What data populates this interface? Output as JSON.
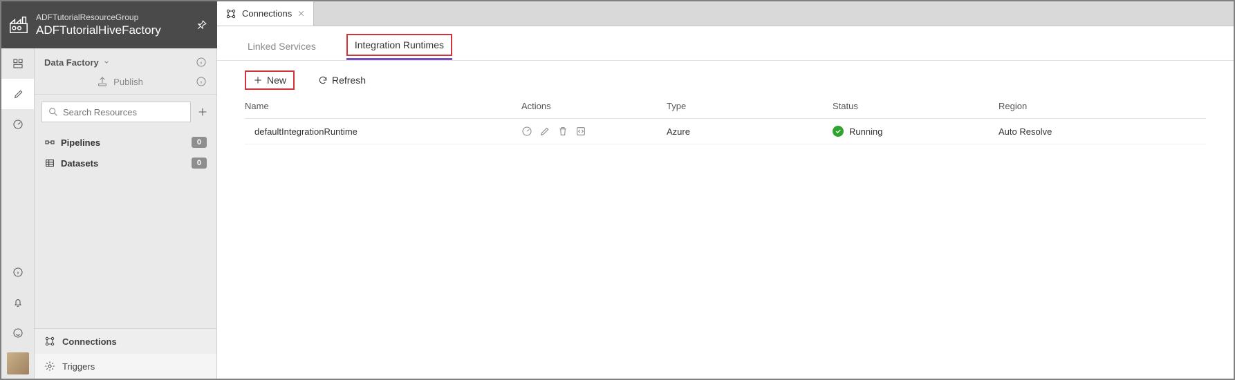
{
  "header": {
    "resource_group": "ADFTutorialResourceGroup",
    "factory_name": "ADFTutorialHiveFactory"
  },
  "sidebar": {
    "breadcrumb": "Data Factory",
    "publish_label": "Publish",
    "search_placeholder": "Search Resources",
    "tree": [
      {
        "label": "Pipelines",
        "count": "0"
      },
      {
        "label": "Datasets",
        "count": "0"
      }
    ],
    "bottom": [
      {
        "label": "Connections"
      },
      {
        "label": "Triggers"
      }
    ]
  },
  "document_tab": {
    "title": "Connections"
  },
  "subtabs": {
    "linked_services": "Linked Services",
    "integration_runtimes": "Integration Runtimes"
  },
  "toolbar": {
    "new_label": "New",
    "refresh_label": "Refresh"
  },
  "table": {
    "headers": {
      "name": "Name",
      "actions": "Actions",
      "type": "Type",
      "status": "Status",
      "region": "Region"
    },
    "rows": [
      {
        "name": "defaultIntegrationRuntime",
        "type": "Azure",
        "status": "Running",
        "region": "Auto Resolve"
      }
    ]
  },
  "icons": {
    "factory": "factory-icon",
    "pin": "pin-icon",
    "info": "info-icon",
    "upload": "upload-icon",
    "search": "search-icon",
    "plus": "plus-icon",
    "pipeline": "pipeline-icon",
    "dataset": "dataset-icon",
    "connections": "connections-icon",
    "triggers": "triggers-icon",
    "dashboard": "dashboard-icon",
    "pencil": "pencil-icon",
    "gauge": "gauge-icon",
    "bell": "bell-icon",
    "smile": "smile-icon",
    "refresh": "refresh-icon",
    "monitor": "monitor-icon",
    "edit": "edit-icon",
    "delete": "delete-icon",
    "code": "code-icon",
    "check": "check-icon",
    "chevron": "chevron-down-icon",
    "close": "close-icon"
  }
}
